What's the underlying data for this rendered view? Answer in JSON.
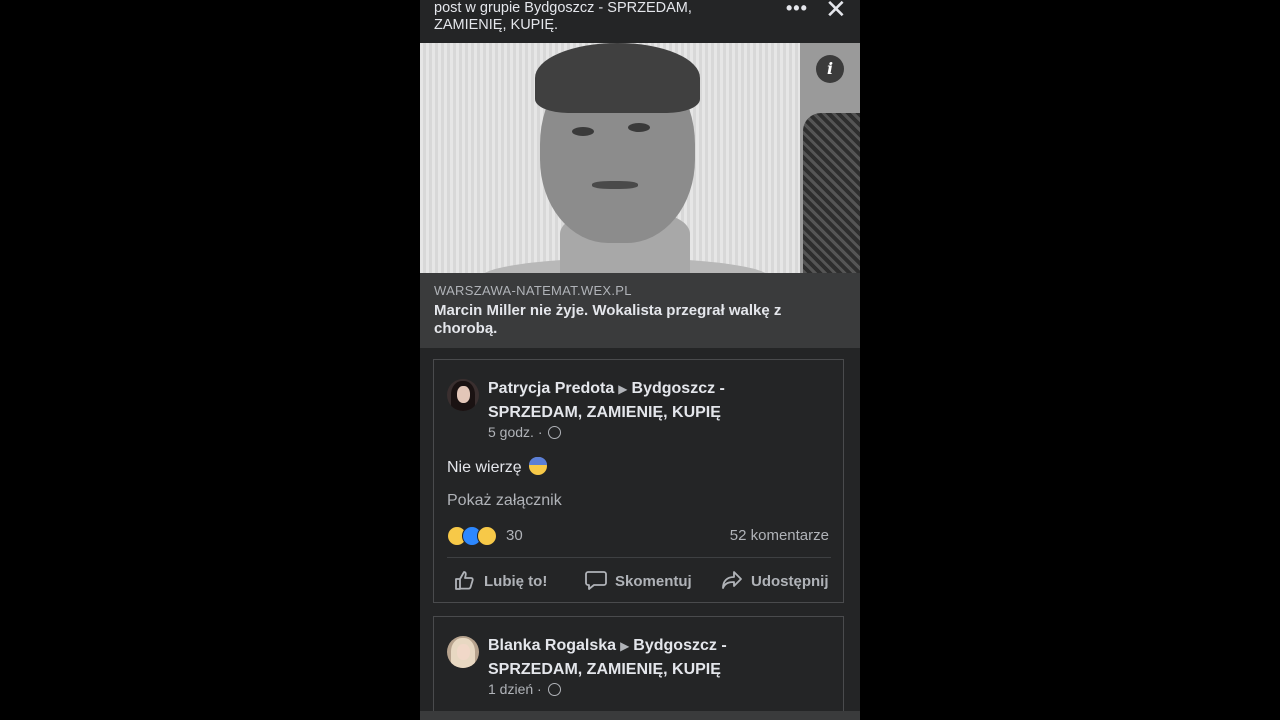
{
  "header": {
    "title": "post w grupie Bydgoszcz - SPRZEDAM, ZAMIENIĘ, KUPIĘ.",
    "more_label": "•••",
    "close_label": "✕"
  },
  "photo": {
    "info_label": "i"
  },
  "link_preview": {
    "domain": "WARSZAWA-NATEMAT.WEX.PL",
    "headline": "Marcin Miller nie żyje. Wokalista przegrał walkę z chorobą."
  },
  "posts": [
    {
      "author": "Patrycja Predota",
      "group": "Bydgoszcz - SPRZEDAM, ZAMIENIĘ, KUPIĘ",
      "time": "5 godz. ·",
      "text": "Nie wierzę",
      "attachment_label": "Pokaż załącznik",
      "reaction_count": "30",
      "comment_count": "52 komentarze",
      "actions": {
        "like": "Lubię to!",
        "comment": "Skomentuj",
        "share": "Udostępnij"
      }
    },
    {
      "author": "Blanka Rogalska",
      "group": "Bydgoszcz - SPRZEDAM, ZAMIENIĘ, KUPIĘ",
      "time": "1 dzień ·"
    }
  ],
  "colors": {
    "background": "#242526",
    "text": "#e4e6eb",
    "muted": "#b0b3b8",
    "like_blue": "#2d88ff"
  }
}
